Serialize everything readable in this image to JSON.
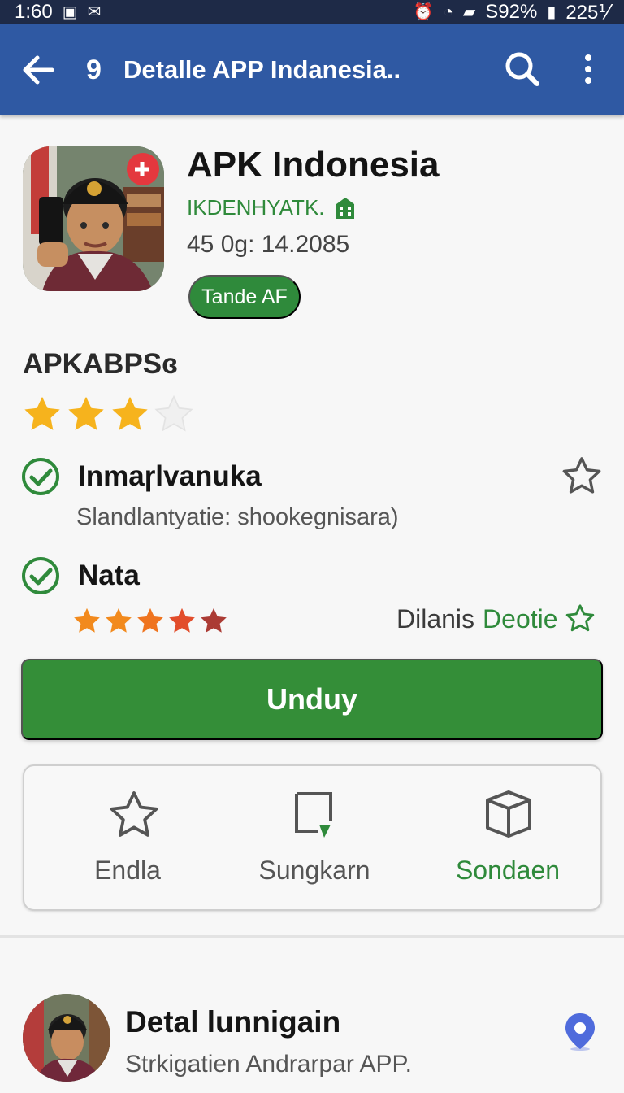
{
  "status_bar": {
    "time": "1:60",
    "battery_text": "S92%",
    "extra_text": "225⅟",
    "left_icons": [
      "notification-icon",
      "mail-icon"
    ],
    "right_icons": [
      "alarm-icon",
      "wifi-icon",
      "signal-icon",
      "battery-icon"
    ]
  },
  "app_bar": {
    "back_icon": "back-arrow-icon",
    "number": "9",
    "title": "Detalle APP Indanesia..",
    "search_icon": "search-icon",
    "more_icon": "more-vertical-icon"
  },
  "app": {
    "name": "APK Indonesia",
    "developer": "IKDENHYATK.",
    "developer_icon": "building-icon",
    "meta": "45 0g: 14.2085",
    "tag": "Tande AF",
    "icon_badge": "notification-badge"
  },
  "section": {
    "title": "APKABPSɞ",
    "rating": 3,
    "rating_max": 4
  },
  "features": [
    {
      "title": "Inmaɼlvanuka",
      "subtitle": "Slandlantyatie: shookegnisara)",
      "icon": "check-circle-icon"
    },
    {
      "title": "Nata",
      "icon": "check-circle-icon",
      "rating": 5,
      "rating_max": 5
    }
  ],
  "details_link": {
    "gray_text": "Dilanis",
    "green_text": "Deotie",
    "star_icon": "star-outline-icon"
  },
  "download_button": {
    "label": "Unduy"
  },
  "actions": [
    {
      "label": "Endla",
      "icon": "star-outline-icon"
    },
    {
      "label": "Sungkarn",
      "icon": "share-box-icon"
    },
    {
      "label": "Sondaen",
      "icon": "box-icon",
      "active": true
    }
  ],
  "related": {
    "title": "Detal lunnigain",
    "subtitle": "Strkigatien Andrarpar APP.",
    "pin_icon": "location-pin-icon"
  },
  "colors": {
    "status_bar": "#1e2a47",
    "app_bar": "#2f59a3",
    "green": "#348e38",
    "star_gold": "#f6b31d",
    "star_orange": "#ec5a28",
    "pin_blue": "#4f6bdc"
  }
}
